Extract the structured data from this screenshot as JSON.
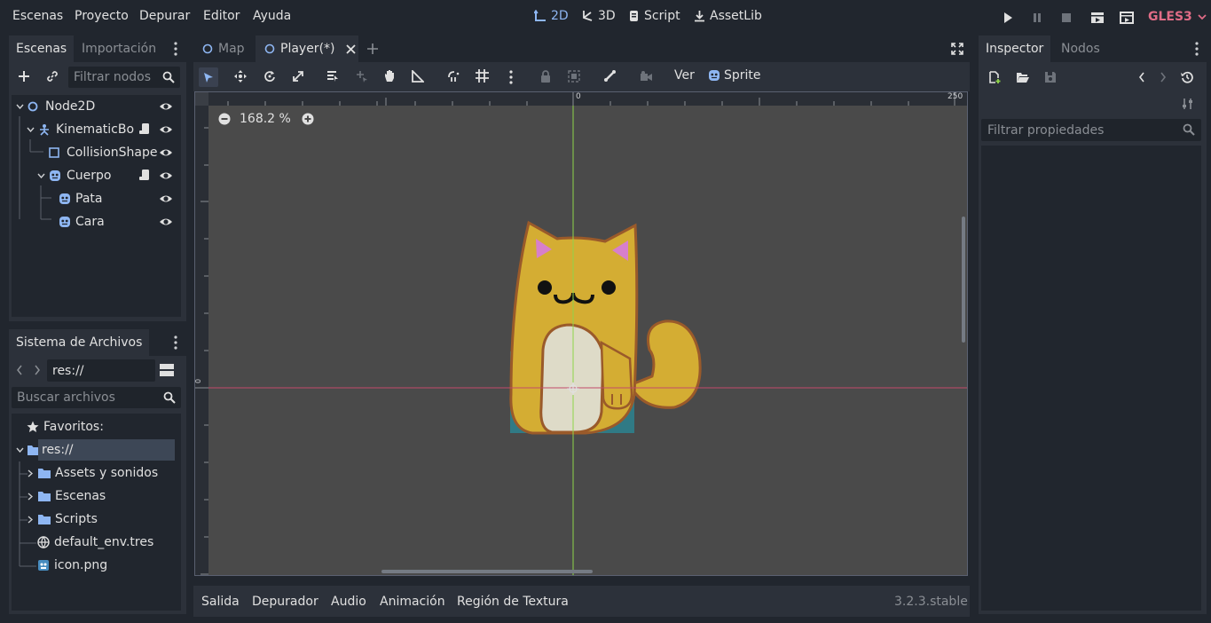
{
  "menubar": {
    "items": [
      "Escenas",
      "Proyecto",
      "Depurar",
      "Editor",
      "Ayuda"
    ],
    "workspaces": [
      {
        "label": "2D",
        "icon": "2d-icon",
        "active": true
      },
      {
        "label": "3D",
        "icon": "3d-icon",
        "active": false
      },
      {
        "label": "Script",
        "icon": "script-icon",
        "active": false
      },
      {
        "label": "AssetLib",
        "icon": "assetlib-icon",
        "active": false
      }
    ],
    "renderer": "GLES3"
  },
  "scene_dock": {
    "tabs": [
      "Escenas",
      "Importación"
    ],
    "filter_placeholder": "Filtrar nodos",
    "nodes": [
      {
        "label": "Node2D",
        "icon": "node2d-icon"
      },
      {
        "label": "KinematicBo",
        "icon": "kinematicbody-icon"
      },
      {
        "label": "CollisionShape",
        "icon": "collisionshape-icon"
      },
      {
        "label": "Cuerpo",
        "icon": "sprite-icon"
      },
      {
        "label": "Pata",
        "icon": "sprite-icon"
      },
      {
        "label": "Cara",
        "icon": "sprite-icon"
      }
    ]
  },
  "filesystem_dock": {
    "title": "Sistema de Archivos",
    "path": "res://",
    "search_placeholder": "Buscar archivos",
    "items": [
      {
        "label": "Favoritos:",
        "icon": "star-icon"
      },
      {
        "label": "res://",
        "icon": "folder-icon"
      },
      {
        "label": "Assets y sonidos",
        "icon": "folder-icon"
      },
      {
        "label": "Escenas",
        "icon": "folder-icon"
      },
      {
        "label": "Scripts",
        "icon": "folder-icon"
      },
      {
        "label": "default_env.tres",
        "icon": "environment-icon"
      },
      {
        "label": "icon.png",
        "icon": "image-icon"
      }
    ]
  },
  "editor": {
    "scene_tabs": [
      "Map",
      "Player(*)"
    ],
    "toolbar": {
      "view_label": "Ver",
      "sprite_label": "Sprite"
    },
    "zoom": "168.2 %",
    "ruler": {
      "origin_label": "0",
      "end_label": "250",
      "vertical_origin": "0"
    }
  },
  "bottom_panel": {
    "tabs": [
      "Salida",
      "Depurador",
      "Audio",
      "Animación",
      "Región de Textura"
    ],
    "version": "3.2.3.stable"
  },
  "inspector_dock": {
    "tabs": [
      "Inspector",
      "Nodos"
    ],
    "filter_placeholder": "Filtrar propiedades"
  },
  "colors": {
    "accent": "#8eb6f2",
    "renderer": "#e06c86",
    "axis_x": "#c24a6a",
    "axis_y": "#8fd44a",
    "cat_body": "#d4ad33",
    "cat_outline": "#9a5a2a",
    "cat_belly": "#dedbc8"
  }
}
